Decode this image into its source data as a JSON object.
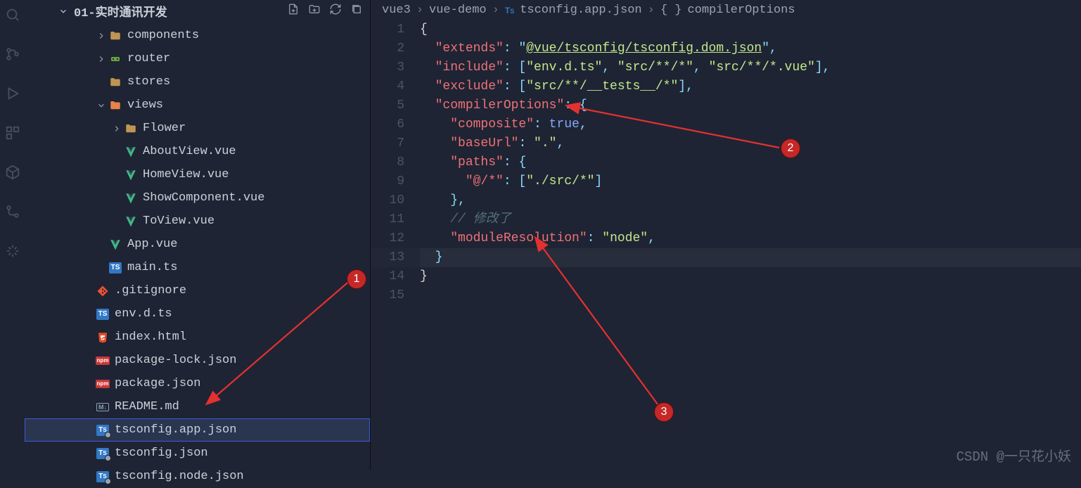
{
  "sidebar": {
    "header_title": "01-实时通讯开发",
    "tree": [
      {
        "indent": 100,
        "chev": "right",
        "icon": "folder",
        "label": "components"
      },
      {
        "indent": 100,
        "chev": "right",
        "icon": "router",
        "label": "router"
      },
      {
        "indent": 100,
        "chev": "",
        "icon": "folder",
        "label": "stores"
      },
      {
        "indent": 100,
        "chev": "down",
        "icon": "views",
        "label": "views"
      },
      {
        "indent": 122,
        "chev": "right",
        "icon": "folder",
        "label": "Flower"
      },
      {
        "indent": 122,
        "chev": "",
        "icon": "vue",
        "label": "AboutView.vue"
      },
      {
        "indent": 122,
        "chev": "",
        "icon": "vue",
        "label": "HomeView.vue"
      },
      {
        "indent": 122,
        "chev": "",
        "icon": "vue",
        "label": "ShowComponent.vue"
      },
      {
        "indent": 122,
        "chev": "",
        "icon": "vue",
        "label": "ToView.vue"
      },
      {
        "indent": 100,
        "chev": "",
        "icon": "vue",
        "label": "App.vue"
      },
      {
        "indent": 100,
        "chev": "",
        "icon": "ts",
        "label": "main.ts"
      },
      {
        "indent": 82,
        "chev": "",
        "icon": "git",
        "label": ".gitignore"
      },
      {
        "indent": 82,
        "chev": "",
        "icon": "ts",
        "label": "env.d.ts"
      },
      {
        "indent": 82,
        "chev": "",
        "icon": "html",
        "label": "index.html"
      },
      {
        "indent": 82,
        "chev": "",
        "icon": "npm",
        "label": "package-lock.json"
      },
      {
        "indent": 82,
        "chev": "",
        "icon": "npm",
        "label": "package.json"
      },
      {
        "indent": 82,
        "chev": "",
        "icon": "md",
        "label": "README.md"
      },
      {
        "indent": 82,
        "chev": "",
        "icon": "tsconf",
        "label": "tsconfig.app.json",
        "selected": true
      },
      {
        "indent": 82,
        "chev": "",
        "icon": "tsconf",
        "label": "tsconfig.json"
      },
      {
        "indent": 82,
        "chev": "",
        "icon": "tsconf",
        "label": "tsconfig.node.json"
      }
    ]
  },
  "breadcrumbs": {
    "p0": "vue3",
    "p1": "vue-demo",
    "p2": "tsconfig.app.json",
    "p3": "compilerOptions",
    "p3_icon": "{ }"
  },
  "code": {
    "lines": [
      [
        {
          "t": "brace",
          "v": "{"
        }
      ],
      [
        {
          "t": "sp",
          "v": "  "
        },
        {
          "t": "key",
          "v": "\"extends\""
        },
        {
          "t": "punc",
          "v": ": "
        },
        {
          "t": "punc",
          "v": "\""
        },
        {
          "t": "link",
          "v": "@vue/tsconfig/tsconfig.dom.json"
        },
        {
          "t": "punc",
          "v": "\","
        }
      ],
      [
        {
          "t": "sp",
          "v": "  "
        },
        {
          "t": "key",
          "v": "\"include\""
        },
        {
          "t": "punc",
          "v": ": ["
        },
        {
          "t": "str",
          "v": "\"env.d.ts\""
        },
        {
          "t": "punc",
          "v": ", "
        },
        {
          "t": "str",
          "v": "\"src/**/*\""
        },
        {
          "t": "punc",
          "v": ", "
        },
        {
          "t": "str",
          "v": "\"src/**/*.vue\""
        },
        {
          "t": "punc",
          "v": "],"
        }
      ],
      [
        {
          "t": "sp",
          "v": "  "
        },
        {
          "t": "key",
          "v": "\"exclude\""
        },
        {
          "t": "punc",
          "v": ": ["
        },
        {
          "t": "str",
          "v": "\"src/**/__tests__/*\""
        },
        {
          "t": "punc",
          "v": "],"
        }
      ],
      [
        {
          "t": "sp",
          "v": "  "
        },
        {
          "t": "key",
          "v": "\"compilerOptions\""
        },
        {
          "t": "punc",
          "v": ": {"
        }
      ],
      [
        {
          "t": "sp",
          "v": "    "
        },
        {
          "t": "key",
          "v": "\"composite\""
        },
        {
          "t": "punc",
          "v": ": "
        },
        {
          "t": "bool",
          "v": "true"
        },
        {
          "t": "punc",
          "v": ","
        }
      ],
      [
        {
          "t": "sp",
          "v": "    "
        },
        {
          "t": "key",
          "v": "\"baseUrl\""
        },
        {
          "t": "punc",
          "v": ": "
        },
        {
          "t": "str",
          "v": "\".\""
        },
        {
          "t": "punc",
          "v": ","
        }
      ],
      [
        {
          "t": "sp",
          "v": "    "
        },
        {
          "t": "key",
          "v": "\"paths\""
        },
        {
          "t": "punc",
          "v": ": {"
        }
      ],
      [
        {
          "t": "sp",
          "v": "      "
        },
        {
          "t": "key",
          "v": "\"@/*\""
        },
        {
          "t": "punc",
          "v": ": ["
        },
        {
          "t": "str",
          "v": "\"./src/*\""
        },
        {
          "t": "punc",
          "v": "]"
        }
      ],
      [
        {
          "t": "sp",
          "v": "    "
        },
        {
          "t": "punc",
          "v": "},"
        }
      ],
      [
        {
          "t": "sp",
          "v": "    "
        },
        {
          "t": "comment",
          "v": "// 修改了"
        }
      ],
      [
        {
          "t": "sp",
          "v": "    "
        },
        {
          "t": "key",
          "v": "\"moduleResolution\""
        },
        {
          "t": "punc",
          "v": ": "
        },
        {
          "t": "str",
          "v": "\"node\""
        },
        {
          "t": "punc",
          "v": ","
        }
      ],
      [
        {
          "t": "sp",
          "v": "  "
        },
        {
          "t": "punc",
          "v": "}"
        }
      ],
      [
        {
          "t": "brace",
          "v": "}"
        }
      ],
      []
    ],
    "highlight_line": 13
  },
  "annotations": {
    "b1": "1",
    "b2": "2",
    "b3": "3"
  },
  "watermark": "CSDN @一只花小妖"
}
